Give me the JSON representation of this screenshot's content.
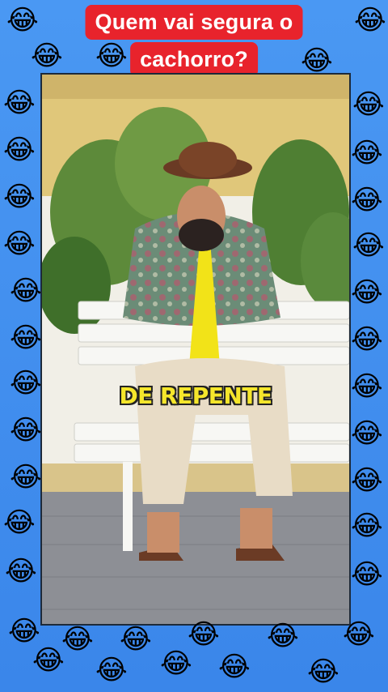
{
  "title": {
    "line1": "Quem vai segura o",
    "line2": "cachorro?"
  },
  "video": {
    "subtitle": "DE REPENTE"
  },
  "decor": {
    "emoji": "😂",
    "emoji_name": "laughing-face-emoji",
    "background_color": "#3d8ff0",
    "title_color": "#e8232c",
    "subtitle_color": "#f5e62b"
  }
}
